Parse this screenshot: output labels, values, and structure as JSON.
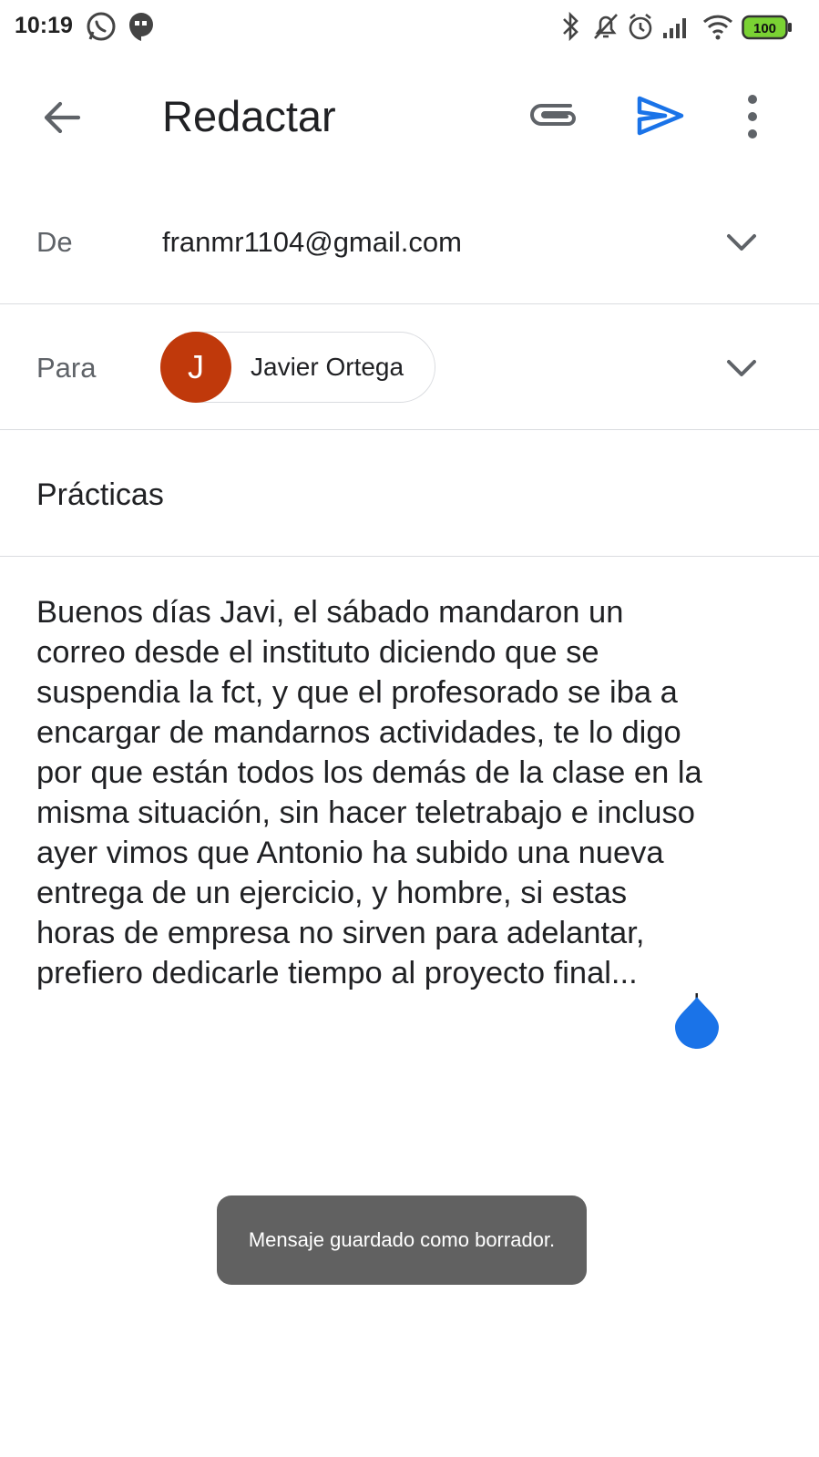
{
  "status_bar": {
    "time": "10:19",
    "battery": "100",
    "left_icons": [
      "whatsapp-icon",
      "hangouts-icon"
    ],
    "right_icons": [
      "bluetooth-icon",
      "notifications-muted-icon",
      "alarm-icon",
      "signal-icon",
      "wifi-icon",
      "battery-icon"
    ]
  },
  "app_bar": {
    "title": "Redactar",
    "accent_color": "#1a73e8"
  },
  "from": {
    "label": "De",
    "value": "franmr1104@gmail.com"
  },
  "to": {
    "label": "Para",
    "recipient_initial": "J",
    "recipient_name": "Javier Ortega",
    "avatar_color": "#c0390b"
  },
  "subject": "Prácticas",
  "body": {
    "text": "Buenos días Javi, el sábado mandaron un\ncorreo desde el instituto diciendo que se\nsuspendia la fct, y que el profesorado se iba a\nencargar de mandarnos actividades, te lo digo\npor que están todos los demás de la clase en la\nmisma situación, sin hacer teletrabajo e incluso\nayer vimos que Antonio ha subido una nueva\nentrega de un ejercicio, y hombre, si estas\nhoras de empresa no sirven para adelantar,\nprefiero dedicarle tiempo al proyecto final..."
  },
  "toast": {
    "message": "Mensaje guardado como borrador."
  }
}
